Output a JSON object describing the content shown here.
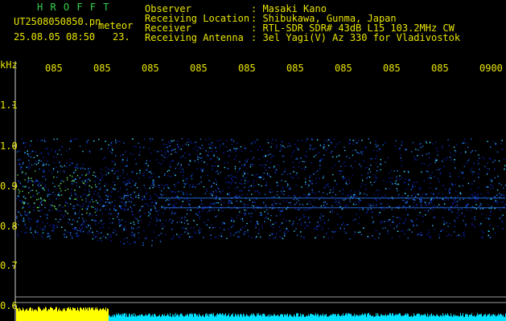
{
  "header": {
    "logo": "H R O F F T",
    "filename": "UT2508050850.pn",
    "mode": "meteor",
    "datetime": "25.08.05 08:50",
    "frame": "23.",
    "fields": [
      {
        "label": "Observer",
        "value": ": Masaki Kano"
      },
      {
        "label": "Receiving Location",
        "value": ": Shibukawa, Gunma, Japan"
      },
      {
        "label": "Receiver",
        "value": ": RTL-SDR SDR# 43dB L15 103.2MHz CW"
      },
      {
        "label": "Receiving Antenna",
        "value": ": 3el Yagi(V) Az 330 for Vladivostok"
      }
    ]
  },
  "time_ticks": [
    "085",
    "085",
    "085",
    "085",
    "085",
    "085",
    "085",
    "085",
    "085",
    "0900"
  ],
  "yaxis": {
    "unit": "kHz",
    "labels": [
      "1.1",
      "1.0",
      "0.9",
      "0.8",
      "0.7",
      "0.6"
    ]
  },
  "colors": {
    "text": "#e8e400",
    "logo": "#34d24a",
    "signal_low": "#0a1ea0",
    "signal_high": "#3ad7ff",
    "power_bar": "#ffff00",
    "power_bar2": "#00e0ff",
    "axis": "#cfcfcf"
  }
}
